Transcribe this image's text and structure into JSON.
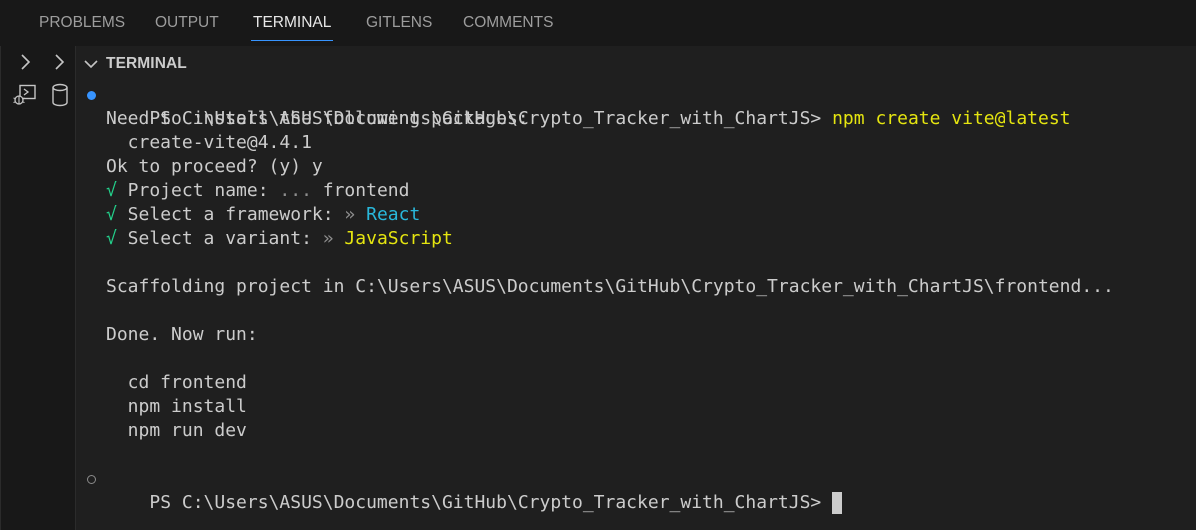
{
  "tabs": [
    {
      "label": "PROBLEMS",
      "active": false
    },
    {
      "label": "OUTPUT",
      "active": false
    },
    {
      "label": "TERMINAL",
      "active": true
    },
    {
      "label": "GITLENS",
      "active": false
    },
    {
      "label": "COMMENTS",
      "active": false
    }
  ],
  "section": {
    "title": "TERMINAL"
  },
  "icons": {
    "left_top_1": "chevron-right-icon",
    "left_top_2": "chevron-right-icon",
    "left_bottom_1": "debug-console-icon",
    "left_bottom_2": "database-icon",
    "section_toggle": "chevron-down-icon"
  },
  "colors": {
    "accent": "#3794ff",
    "prompt_cmd": "#e5e510",
    "check": "#23d18b",
    "react": "#29b8db",
    "javascript": "#e5e510"
  },
  "terminal": {
    "prompt1": "PS C:\\Users\\ASUS\\Documents\\GitHub\\Crypto_Tracker_with_ChartJS> ",
    "command": "npm create vite@latest",
    "line_need": "Need to install the following packages:",
    "line_pkg": "  create-vite@4.4.1",
    "line_ok": "Ok to proceed? (y) y",
    "check": "√",
    "project_name_label": " Project name: ",
    "project_name_sep": "...",
    "project_name_value": " frontend",
    "framework_label": " Select a framework: ",
    "framework_sep": "»",
    "framework_value": " React",
    "variant_label": " Select a variant: ",
    "variant_sep": "»",
    "variant_value": " JavaScript",
    "scaffolding": "Scaffolding project in C:\\Users\\ASUS\\Documents\\GitHub\\Crypto_Tracker_with_ChartJS\\frontend...",
    "done": "Done. Now run:",
    "run_cd": "  cd frontend",
    "run_install": "  npm install",
    "run_dev": "  npm run dev",
    "prompt2": "PS C:\\Users\\ASUS\\Documents\\GitHub\\Crypto_Tracker_with_ChartJS> "
  }
}
